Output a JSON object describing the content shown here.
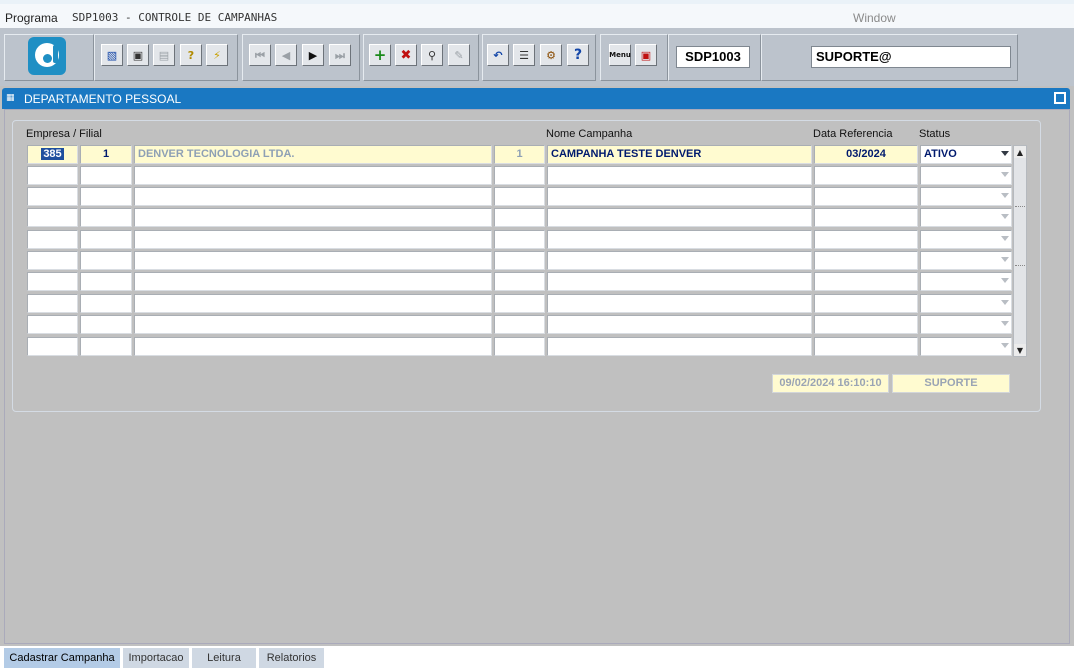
{
  "menu": {
    "programa": "Programa",
    "title": "SDP1003 - CONTROLE DE CAMPANHAS",
    "window": "Window"
  },
  "toolbar": {
    "program_code": "SDP1003",
    "user": "SUPORTE@",
    "buttons": [
      "save-icon",
      "form-icon",
      "print-icon",
      "query-icon",
      "execute-query-icon",
      "first-record-icon",
      "previous-record-icon",
      "next-record-icon",
      "last-record-icon",
      "insert-record-icon",
      "delete-record-icon",
      "find-icon",
      "clear-icon",
      "undo-icon",
      "clipboard-icon",
      "settings-icon",
      "help-icon",
      "menu-icon",
      "exit-icon"
    ],
    "menu_icon_label": "Menu"
  },
  "panel": {
    "title": "DEPARTAMENTO PESSOAL"
  },
  "grid": {
    "headers": {
      "empresa_filial": "Empresa / Filial",
      "nome_campanha": "Nome Campanha",
      "data_referencia": "Data Referencia",
      "status": "Status"
    },
    "rows": [
      {
        "empresa": "385",
        "filial": "1",
        "nome_empresa": "DENVER TECNOLOGIA LTDA.",
        "codigo": "1",
        "campanha": "CAMPANHA TESTE DENVER",
        "data": "03/2024",
        "status": "ATIVO"
      },
      {
        "empresa": "",
        "filial": "",
        "nome_empresa": "",
        "codigo": "",
        "campanha": "",
        "data": "",
        "status": ""
      },
      {
        "empresa": "",
        "filial": "",
        "nome_empresa": "",
        "codigo": "",
        "campanha": "",
        "data": "",
        "status": ""
      },
      {
        "empresa": "",
        "filial": "",
        "nome_empresa": "",
        "codigo": "",
        "campanha": "",
        "data": "",
        "status": ""
      },
      {
        "empresa": "",
        "filial": "",
        "nome_empresa": "",
        "codigo": "",
        "campanha": "",
        "data": "",
        "status": ""
      },
      {
        "empresa": "",
        "filial": "",
        "nome_empresa": "",
        "codigo": "",
        "campanha": "",
        "data": "",
        "status": ""
      },
      {
        "empresa": "",
        "filial": "",
        "nome_empresa": "",
        "codigo": "",
        "campanha": "",
        "data": "",
        "status": ""
      },
      {
        "empresa": "",
        "filial": "",
        "nome_empresa": "",
        "codigo": "",
        "campanha": "",
        "data": "",
        "status": ""
      },
      {
        "empresa": "",
        "filial": "",
        "nome_empresa": "",
        "codigo": "",
        "campanha": "",
        "data": "",
        "status": ""
      },
      {
        "empresa": "",
        "filial": "",
        "nome_empresa": "",
        "codigo": "",
        "campanha": "",
        "data": "",
        "status": ""
      }
    ]
  },
  "footer": {
    "timestamp": "09/02/2024 16:10:10",
    "user": "SUPORTE"
  },
  "tabs": [
    {
      "label": "Cadastrar Campanha",
      "active": true
    },
    {
      "label": "Importacao",
      "active": false
    },
    {
      "label": "Leitura",
      "active": false
    },
    {
      "label": "Relatorios",
      "active": false
    }
  ]
}
